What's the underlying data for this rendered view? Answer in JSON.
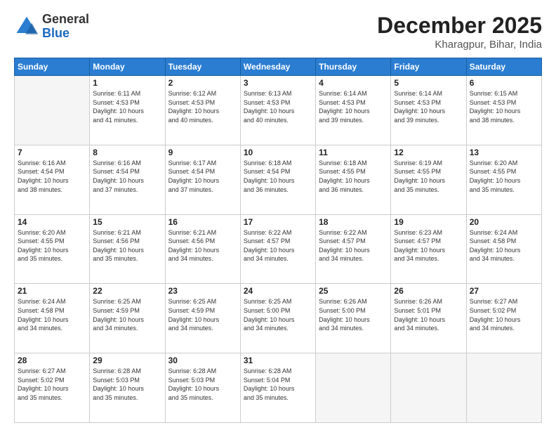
{
  "header": {
    "logo_general": "General",
    "logo_blue": "Blue",
    "month_year": "December 2025",
    "location": "Kharagpur, Bihar, India"
  },
  "weekdays": [
    "Sunday",
    "Monday",
    "Tuesday",
    "Wednesday",
    "Thursday",
    "Friday",
    "Saturday"
  ],
  "weeks": [
    [
      {
        "day": "",
        "info": ""
      },
      {
        "day": "1",
        "info": "Sunrise: 6:11 AM\nSunset: 4:53 PM\nDaylight: 10 hours\nand 41 minutes."
      },
      {
        "day": "2",
        "info": "Sunrise: 6:12 AM\nSunset: 4:53 PM\nDaylight: 10 hours\nand 40 minutes."
      },
      {
        "day": "3",
        "info": "Sunrise: 6:13 AM\nSunset: 4:53 PM\nDaylight: 10 hours\nand 40 minutes."
      },
      {
        "day": "4",
        "info": "Sunrise: 6:14 AM\nSunset: 4:53 PM\nDaylight: 10 hours\nand 39 minutes."
      },
      {
        "day": "5",
        "info": "Sunrise: 6:14 AM\nSunset: 4:53 PM\nDaylight: 10 hours\nand 39 minutes."
      },
      {
        "day": "6",
        "info": "Sunrise: 6:15 AM\nSunset: 4:53 PM\nDaylight: 10 hours\nand 38 minutes."
      }
    ],
    [
      {
        "day": "7",
        "info": "Sunrise: 6:16 AM\nSunset: 4:54 PM\nDaylight: 10 hours\nand 38 minutes."
      },
      {
        "day": "8",
        "info": "Sunrise: 6:16 AM\nSunset: 4:54 PM\nDaylight: 10 hours\nand 37 minutes."
      },
      {
        "day": "9",
        "info": "Sunrise: 6:17 AM\nSunset: 4:54 PM\nDaylight: 10 hours\nand 37 minutes."
      },
      {
        "day": "10",
        "info": "Sunrise: 6:18 AM\nSunset: 4:54 PM\nDaylight: 10 hours\nand 36 minutes."
      },
      {
        "day": "11",
        "info": "Sunrise: 6:18 AM\nSunset: 4:55 PM\nDaylight: 10 hours\nand 36 minutes."
      },
      {
        "day": "12",
        "info": "Sunrise: 6:19 AM\nSunset: 4:55 PM\nDaylight: 10 hours\nand 35 minutes."
      },
      {
        "day": "13",
        "info": "Sunrise: 6:20 AM\nSunset: 4:55 PM\nDaylight: 10 hours\nand 35 minutes."
      }
    ],
    [
      {
        "day": "14",
        "info": "Sunrise: 6:20 AM\nSunset: 4:55 PM\nDaylight: 10 hours\nand 35 minutes."
      },
      {
        "day": "15",
        "info": "Sunrise: 6:21 AM\nSunset: 4:56 PM\nDaylight: 10 hours\nand 35 minutes."
      },
      {
        "day": "16",
        "info": "Sunrise: 6:21 AM\nSunset: 4:56 PM\nDaylight: 10 hours\nand 34 minutes."
      },
      {
        "day": "17",
        "info": "Sunrise: 6:22 AM\nSunset: 4:57 PM\nDaylight: 10 hours\nand 34 minutes."
      },
      {
        "day": "18",
        "info": "Sunrise: 6:22 AM\nSunset: 4:57 PM\nDaylight: 10 hours\nand 34 minutes."
      },
      {
        "day": "19",
        "info": "Sunrise: 6:23 AM\nSunset: 4:57 PM\nDaylight: 10 hours\nand 34 minutes."
      },
      {
        "day": "20",
        "info": "Sunrise: 6:24 AM\nSunset: 4:58 PM\nDaylight: 10 hours\nand 34 minutes."
      }
    ],
    [
      {
        "day": "21",
        "info": "Sunrise: 6:24 AM\nSunset: 4:58 PM\nDaylight: 10 hours\nand 34 minutes."
      },
      {
        "day": "22",
        "info": "Sunrise: 6:25 AM\nSunset: 4:59 PM\nDaylight: 10 hours\nand 34 minutes."
      },
      {
        "day": "23",
        "info": "Sunrise: 6:25 AM\nSunset: 4:59 PM\nDaylight: 10 hours\nand 34 minutes."
      },
      {
        "day": "24",
        "info": "Sunrise: 6:25 AM\nSunset: 5:00 PM\nDaylight: 10 hours\nand 34 minutes."
      },
      {
        "day": "25",
        "info": "Sunrise: 6:26 AM\nSunset: 5:00 PM\nDaylight: 10 hours\nand 34 minutes."
      },
      {
        "day": "26",
        "info": "Sunrise: 6:26 AM\nSunset: 5:01 PM\nDaylight: 10 hours\nand 34 minutes."
      },
      {
        "day": "27",
        "info": "Sunrise: 6:27 AM\nSunset: 5:02 PM\nDaylight: 10 hours\nand 34 minutes."
      }
    ],
    [
      {
        "day": "28",
        "info": "Sunrise: 6:27 AM\nSunset: 5:02 PM\nDaylight: 10 hours\nand 35 minutes."
      },
      {
        "day": "29",
        "info": "Sunrise: 6:28 AM\nSunset: 5:03 PM\nDaylight: 10 hours\nand 35 minutes."
      },
      {
        "day": "30",
        "info": "Sunrise: 6:28 AM\nSunset: 5:03 PM\nDaylight: 10 hours\nand 35 minutes."
      },
      {
        "day": "31",
        "info": "Sunrise: 6:28 AM\nSunset: 5:04 PM\nDaylight: 10 hours\nand 35 minutes."
      },
      {
        "day": "",
        "info": ""
      },
      {
        "day": "",
        "info": ""
      },
      {
        "day": "",
        "info": ""
      }
    ]
  ]
}
